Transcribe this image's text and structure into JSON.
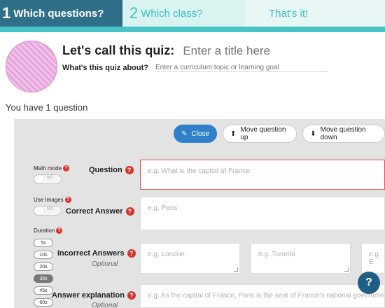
{
  "stepper": {
    "steps": [
      {
        "num": "1",
        "label": "Which questions?"
      },
      {
        "num": "2",
        "label": "Which class?"
      },
      {
        "num": "",
        "label": "That's it!"
      }
    ]
  },
  "header": {
    "title_label": "Let's call this quiz:",
    "title_placeholder": "Enter a title here",
    "about_label": "What's this quiz about?",
    "about_placeholder": "Enter a curriculum topic or learning goal"
  },
  "question_count": "You have 1 question",
  "toolbar": {
    "close_label": "Close",
    "move_up_label": "Move question up",
    "move_down_label": "Move question down"
  },
  "question_form": {
    "math_mode_label": "Math mode",
    "math_toggle_text": "NO",
    "question_label": "Question",
    "question_placeholder": "e.g. What is the capital of France",
    "use_images_label": "Use Images",
    "images_toggle_text": "NO",
    "correct_label": "Correct Answer",
    "correct_placeholder": "e.g. Paris",
    "duration_label": "Duration",
    "durations": [
      "5s",
      "10s",
      "20s",
      "30s",
      "45s",
      "60s"
    ],
    "selected_duration": "30s",
    "incorrect_label": "Incorrect Answers",
    "incorrect_optional": "Optional",
    "incorrect_placeholders": [
      "e.g. London",
      "e.g. Toronto",
      "e.g. E"
    ],
    "explanation_label": "Answer explanation",
    "explanation_optional": "Optional",
    "explanation_placeholder": "e.g. As the capital of France, Paris is the seat of France's national government"
  },
  "help_icon": "question-icon"
}
